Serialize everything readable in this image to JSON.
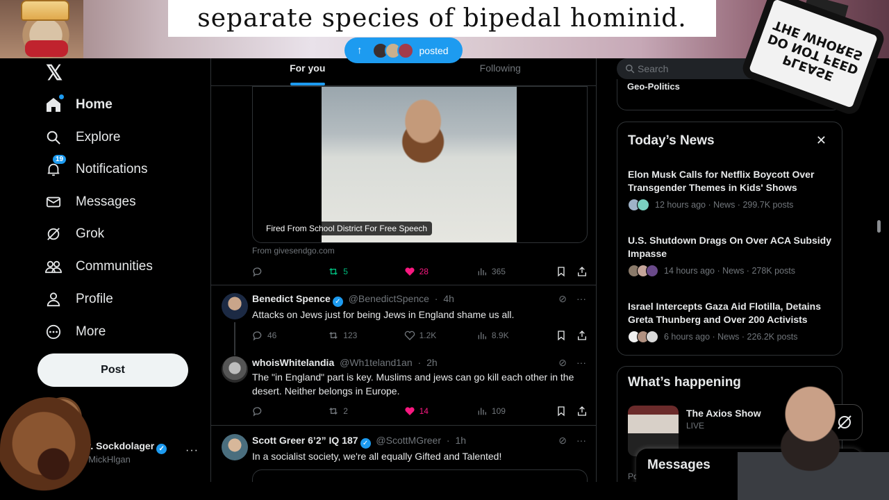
{
  "overlay": {
    "caption": "separate species of bipedal hominid.",
    "sign_lines": [
      "PLEASE",
      "DO NOT FEED",
      "THE WHORES"
    ]
  },
  "sidebar": {
    "logo": "𝕏",
    "items": [
      {
        "label": "Home",
        "icon": "home-icon",
        "active": true
      },
      {
        "label": "Explore",
        "icon": "search-icon"
      },
      {
        "label": "Notifications",
        "icon": "bell-icon",
        "badge": "19"
      },
      {
        "label": "Messages",
        "icon": "mail-icon"
      },
      {
        "label": "Grok",
        "icon": "grok-icon"
      },
      {
        "label": "Communities",
        "icon": "people-icon"
      },
      {
        "label": "Profile",
        "icon": "person-icon"
      },
      {
        "label": "More",
        "icon": "more-circle-icon"
      }
    ],
    "post_button": "Post",
    "profile": {
      "name": "Mr. Sockdolager",
      "handle": "@MickHlgan",
      "more": "···"
    }
  },
  "feed": {
    "tabs": [
      {
        "label": "For you",
        "active": true
      },
      {
        "label": "Following"
      }
    ],
    "posted_pill": "posted",
    "video_card": {
      "caption": "Fired From School District For Free Speech",
      "source": "From givesendgo.com",
      "stats": {
        "replies": "",
        "reposts": "5",
        "likes": "28",
        "views": "365"
      }
    },
    "tweets": [
      {
        "name": "Benedict Spence",
        "verified": true,
        "handle": "@BenedictSpence",
        "time": "4h",
        "text": "Attacks on Jews just for being Jews in England shame us all.",
        "stats": {
          "replies": "46",
          "reposts": "123",
          "likes": "1.2K",
          "views": "8.9K"
        }
      },
      {
        "name": "whoisWhitelandia",
        "verified": false,
        "handle": "@Wh1teland1an",
        "time": "2h",
        "text": "The \"in England\" part is key. Muslims and jews can go kill each other in the desert. Neither belongs in Europe.",
        "stats": {
          "replies": "",
          "reposts": "2",
          "likes": "14",
          "views": "109"
        }
      },
      {
        "name": "Scott Greer 6’2” IQ 187",
        "verified": true,
        "handle": "@ScottMGreer",
        "time": "1h",
        "text": "In a socialist society, we're all equally Gifted and Talented!"
      }
    ]
  },
  "right": {
    "search_placeholder": "Search",
    "geo_label": "Geo-Politics",
    "todays_news": {
      "title": "Today’s News",
      "close": "✕",
      "items": [
        {
          "headline": "Elon Musk Calls for Netflix Boycott Over Transgender Themes in Kids' Shows",
          "meta": "12 hours ago · News · 299.7K posts"
        },
        {
          "headline": "U.S. Shutdown Drags On Over ACA Subsidy Impasse",
          "meta": "14 hours ago · News · 278K posts"
        },
        {
          "headline": "Israel Intercepts Gaza Aid Flotilla, Detains Greta Thunberg and Over 200 Activists",
          "meta": "6 hours ago · News · 226.2K posts"
        }
      ]
    },
    "whats_happening": {
      "title": "What’s happening",
      "item": {
        "name": "The Axios Show",
        "status": "LIVE"
      },
      "footer": "Po"
    }
  },
  "messages_drawer": {
    "title": "Messages"
  },
  "colors": {
    "accent": "#1d9bf0",
    "like": "#f91880",
    "repost": "#00ba7c",
    "muted": "#71767b"
  }
}
